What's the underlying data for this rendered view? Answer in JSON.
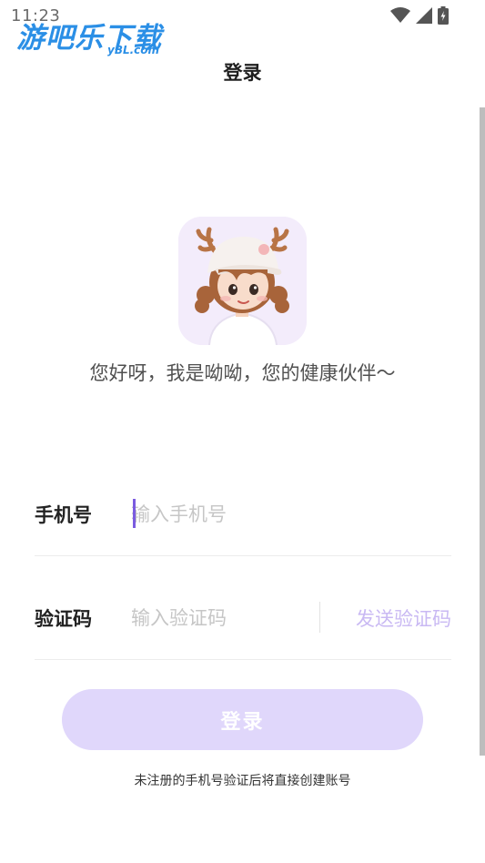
{
  "status_bar": {
    "time": "11:23",
    "icons": [
      "wifi-icon",
      "cell-signal-icon",
      "battery-icon"
    ]
  },
  "watermark": {
    "main": "游吧乐下载",
    "sub": "yBL.com"
  },
  "header": {
    "title": "登录"
  },
  "hero": {
    "avatar": "mascot-avatar",
    "greeting": "您好呀，我是呦呦，您的健康伙伴～"
  },
  "form": {
    "phone": {
      "label": "手机号",
      "placeholder": "输入手机号",
      "value": ""
    },
    "code": {
      "label": "验证码",
      "placeholder": "输入验证码",
      "value": "",
      "send_label": "发送验证码"
    },
    "submit_label": "登录",
    "hint": "未注册的手机号验证后将直接创建账号"
  },
  "colors": {
    "accent": "#7b5ce0",
    "button_disabled_bg": "#e0d7fb",
    "send_code_disabled": "#c9b9f3",
    "avatar_bg": "#f3ecfb"
  }
}
